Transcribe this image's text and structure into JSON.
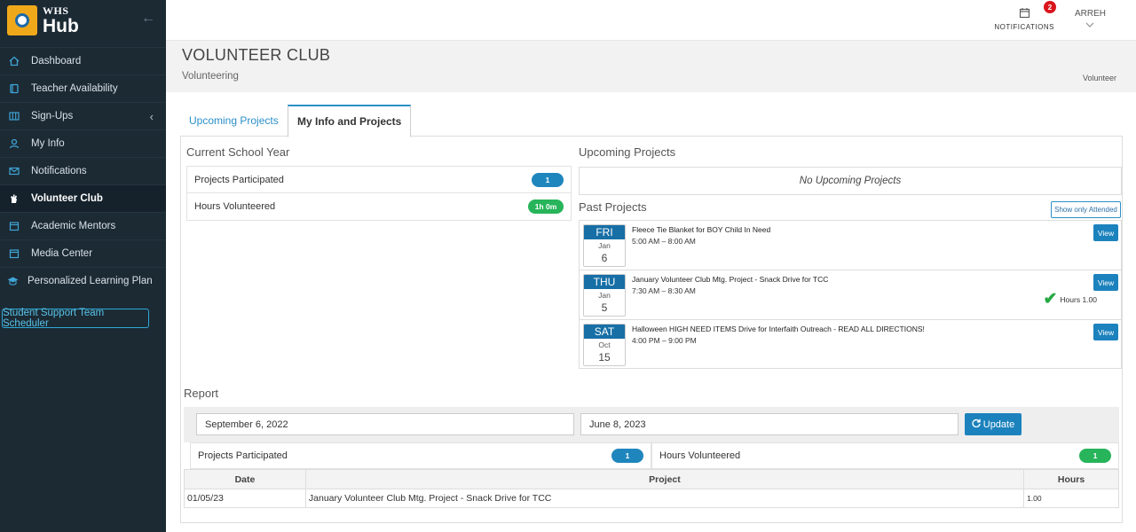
{
  "brand": {
    "small": "WHS",
    "big": "Hub"
  },
  "sidebar": {
    "items": [
      {
        "label": "Dashboard",
        "icon": "home-icon"
      },
      {
        "label": "Teacher Availability",
        "icon": "book-icon"
      },
      {
        "label": "Sign-Ups",
        "icon": "columns-icon"
      },
      {
        "label": "My Info",
        "icon": "user-icon"
      },
      {
        "label": "Notifications",
        "icon": "envelope-icon"
      },
      {
        "label": "Volunteer Club",
        "icon": "hand-icon"
      },
      {
        "label": "Academic Mentors",
        "icon": "calendar-icon"
      },
      {
        "label": "Media Center",
        "icon": "calendar-icon"
      },
      {
        "label": "Personalized Learning Plan",
        "icon": "graduation-cap-icon"
      }
    ],
    "active": "Volunteer Club",
    "support_button": "Student Support Team Scheduler"
  },
  "topbar": {
    "notifications_label": "NOTIFICATIONS",
    "notifications_count": "2",
    "user": "ARREH"
  },
  "header": {
    "title": "VOLUNTEER CLUB",
    "subtitle": "Volunteering",
    "role": "Volunteer"
  },
  "tabs": [
    {
      "label": "Upcoming Projects",
      "active": false
    },
    {
      "label": "My Info and Projects",
      "active": true
    }
  ],
  "current_year": {
    "title": "Current School Year",
    "projects_label": "Projects Participated",
    "projects_value": "1",
    "hours_label": "Hours Volunteered",
    "hours_value": "1h 0m"
  },
  "upcoming": {
    "title": "Upcoming Projects",
    "empty": "No Upcoming Projects"
  },
  "past": {
    "title": "Past Projects",
    "filter_button": "Show only Attended",
    "view_label": "View",
    "items": [
      {
        "dow": "FRI",
        "month": "Jan",
        "day": "6",
        "name": "Fleece Tie Blanket for BOY Child In Need",
        "time": "5:00 AM – 8:00 AM",
        "hours": ""
      },
      {
        "dow": "THU",
        "month": "Jan",
        "day": "5",
        "name": "January Volunteer Club Mtg. Project - Snack Drive for TCC",
        "time": "7:30 AM – 8:30 AM",
        "hours": "Hours 1.00"
      },
      {
        "dow": "SAT",
        "month": "Oct",
        "day": "15",
        "name": "Halloween HIGH NEED ITEMS Drive for Interfaith Outreach - READ ALL DIRECTIONS!",
        "time": "4:00 PM – 9:00 PM",
        "hours": ""
      }
    ]
  },
  "report": {
    "title": "Report",
    "start_date": "September 6, 2022",
    "end_date": "June 8, 2023",
    "update_label": "Update",
    "projects_label": "Projects Participated",
    "projects_value": "1",
    "hours_label": "Hours Volunteered",
    "hours_value": "1",
    "columns": [
      "Date",
      "Project",
      "Hours"
    ],
    "rows": [
      {
        "date": "01/05/23",
        "project": "January Volunteer Club Mtg. Project - Snack Drive for TCC",
        "hours": "1.00"
      }
    ]
  }
}
